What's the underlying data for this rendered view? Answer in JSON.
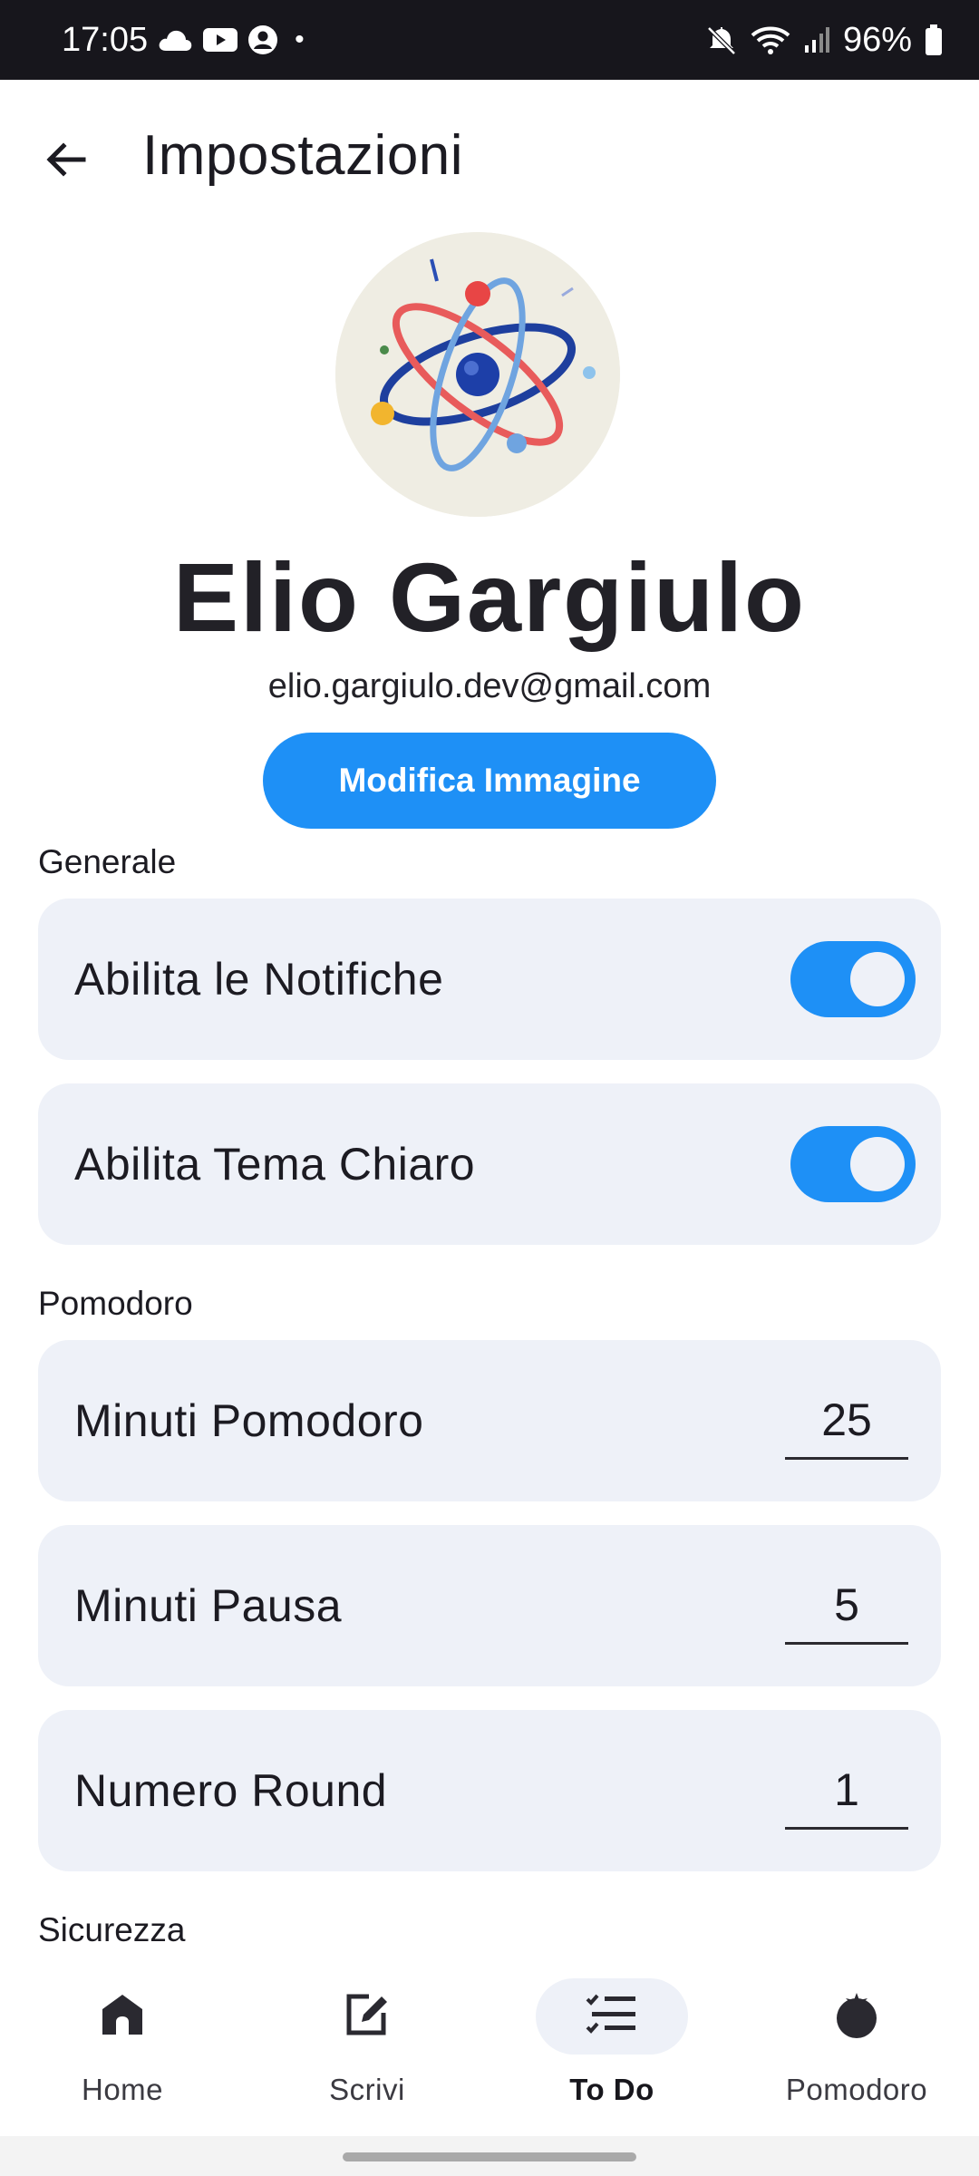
{
  "status_bar": {
    "time": "17:05",
    "dot": "•",
    "battery": "96%",
    "left_icons": [
      "cloud-icon",
      "youtube-icon",
      "account-icon"
    ],
    "right_icons": [
      "mute-icon",
      "wifi-icon",
      "signal-icon",
      "battery-icon"
    ]
  },
  "app_bar": {
    "title": "Impostazioni",
    "back_icon": "arrow-back-icon"
  },
  "profile": {
    "name": "Elio Gargiulo",
    "email": "elio.gargiulo.dev@gmail.com",
    "edit_button": "Modifica Immagine"
  },
  "sections": {
    "general": {
      "label": "Generale",
      "notifications": {
        "label": "Abilita le Notifiche",
        "enabled": true
      },
      "light_theme": {
        "label": "Abilita Tema Chiaro",
        "enabled": true
      }
    },
    "pomodoro": {
      "label": "Pomodoro",
      "pomodoro_minutes": {
        "label": "Minuti Pomodoro",
        "value": "25"
      },
      "pause_minutes": {
        "label": "Minuti Pausa",
        "value": "5"
      },
      "rounds": {
        "label": "Numero Round",
        "value": "1"
      }
    },
    "security": {
      "label": "Sicurezza"
    }
  },
  "bottom_nav": {
    "items": [
      {
        "label": "Home",
        "icon": "home-icon",
        "active": false
      },
      {
        "label": "Scrivi",
        "icon": "edit-icon",
        "active": false
      },
      {
        "label": "To Do",
        "icon": "checklist-icon",
        "active": true
      },
      {
        "label": "Pomodoro",
        "icon": "tomato-icon",
        "active": false
      }
    ]
  },
  "colors": {
    "accent": "#1e90f6",
    "card_background": "#eef1f8",
    "status_bar": "#17161c"
  }
}
